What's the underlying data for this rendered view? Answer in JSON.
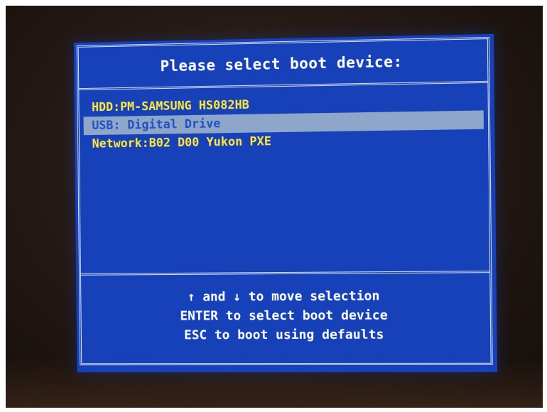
{
  "screen": {
    "title": "Please select boot device:",
    "boot_devices": [
      {
        "label": "HDD:PM-SAMSUNG HS082HB",
        "selected": false
      },
      {
        "label": "USB: Digital Drive",
        "selected": true
      },
      {
        "label": "Network:B02 D00 Yukon PXE",
        "selected": false
      }
    ],
    "help": [
      "↑ and ↓ to move selection",
      "ENTER to select boot device",
      "ESC to boot using defaults"
    ]
  },
  "colors": {
    "screen_background": "#1741b8",
    "item_text": "#ffe83a",
    "selection_highlight": "#8ea6c9",
    "title_text": "#ffffff"
  }
}
